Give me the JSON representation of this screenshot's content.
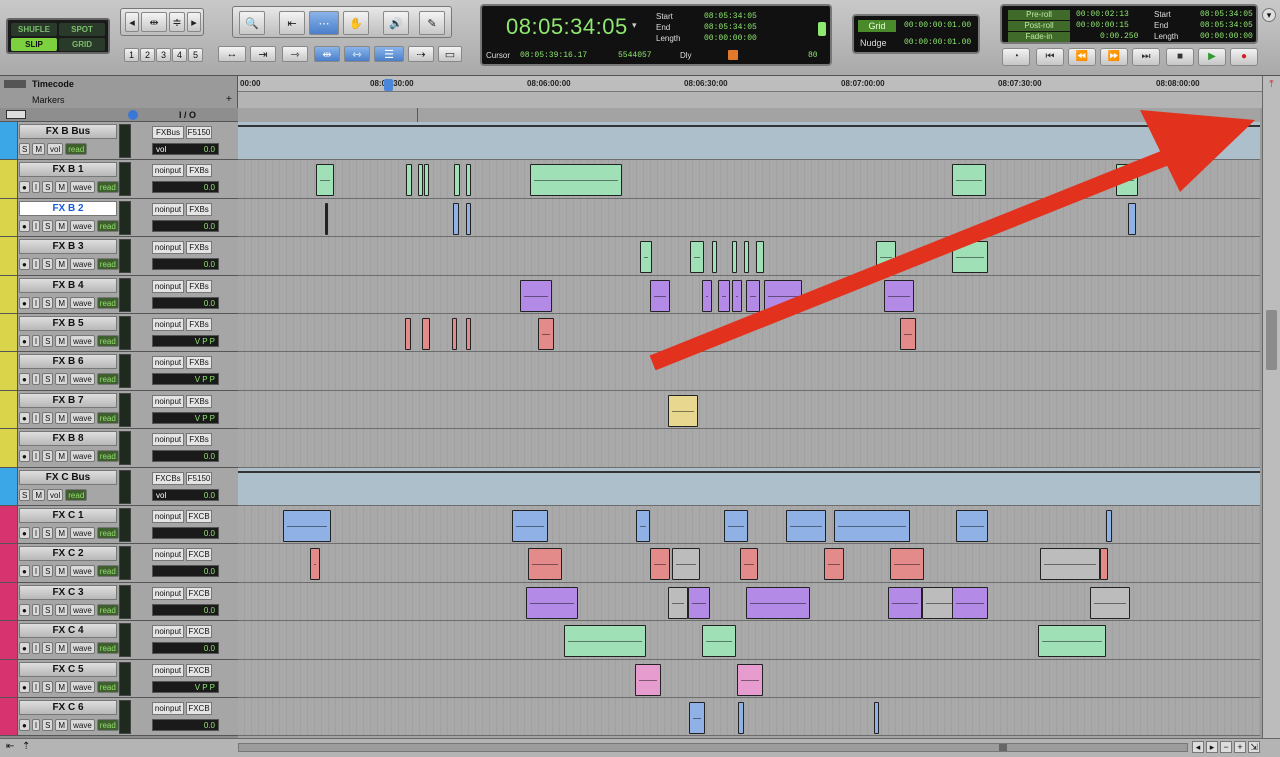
{
  "toolbar": {
    "edit_modes": [
      "SHUFLE",
      "SPOT",
      "SLIP",
      "GRID"
    ],
    "zoom_presets": [
      "1",
      "2",
      "3",
      "4",
      "5"
    ]
  },
  "counter": {
    "main_time": "08:05:34:05",
    "start_label": "Start",
    "start_value": "08:05:34:05",
    "end_label": "End",
    "end_value": "08:05:34:05",
    "length_label": "Length",
    "length_value": "00:00:00:00",
    "cursor_label": "Cursor",
    "cursor_value": "08:05:39:16.17",
    "sample_value": "5544057",
    "dly_label": "Dly",
    "nudge_value": "80"
  },
  "grid": {
    "grid_label": "Grid",
    "grid_value": "00:00:00:01.00",
    "nudge_label": "Nudge",
    "nudge_value": "00:00:00:01.00"
  },
  "transport": {
    "preroll_label": "Pre-roll",
    "preroll_value": "00:00:02:13",
    "postroll_label": "Post-roll",
    "postroll_value": "00:00:00:15",
    "fadein_label": "Fade-in",
    "fadein_value": "0:00.250",
    "start_label": "Start",
    "start_value": "08:05:34:05",
    "end_label": "End",
    "end_value": "08:05:34:05",
    "length_label": "Length",
    "length_value": "00:00:00:00"
  },
  "rulers": {
    "timecode_label": "Timecode",
    "markers_label": "Markers",
    "ticks": [
      "00:00",
      "08:05:30:00",
      "08:06:00:00",
      "08:06:30:00",
      "08:07:00:00",
      "08:07:30:00",
      "08:08:00:00"
    ]
  },
  "mix_header": {
    "io_label": "I / O"
  },
  "colors": {
    "aux_blue": "#3ba7e6",
    "fxb_yellow": "#d9d44a",
    "fxc_magenta": "#d6336f",
    "arrow_red": "#e2321e",
    "clip_green": "#9fe0b6",
    "clip_blue": "#8fb1e6",
    "clip_purple": "#b38be6",
    "clip_red": "#e38a8a",
    "clip_yellow": "#e8d88f",
    "clip_pink": "#e79ccf",
    "clip_gray": "#bcbcbc"
  },
  "tracks": [
    {
      "name": "FX B Bus",
      "type": "aux",
      "color": "#3ba7e6",
      "in": "FXBus",
      "out": "F5150",
      "vol_label": "vol",
      "vol_value": "0.0",
      "mode": "vol",
      "auto": "read"
    },
    {
      "name": "FX B 1",
      "type": "audio",
      "color": "#d9d44a",
      "in": "noinput",
      "out": "FXBs",
      "vol_value": "0.0",
      "mode": "wave",
      "auto": "read"
    },
    {
      "name": "FX B 2",
      "type": "audio",
      "color": "#d9d44a",
      "in": "noinput",
      "out": "FXBs",
      "vol_value": "0.0",
      "mode": "wave",
      "auto": "read",
      "selected": true
    },
    {
      "name": "FX B 3",
      "type": "audio",
      "color": "#d9d44a",
      "in": "noinput",
      "out": "FXBs",
      "vol_value": "0.0",
      "mode": "wave",
      "auto": "read"
    },
    {
      "name": "FX B 4",
      "type": "audio",
      "color": "#d9d44a",
      "in": "noinput",
      "out": "FXBs",
      "vol_value": "0.0",
      "mode": "wave",
      "auto": "read"
    },
    {
      "name": "FX B 5",
      "type": "audio",
      "color": "#d9d44a",
      "in": "noinput",
      "out": "FXBs",
      "vol_value": "V P P",
      "mode": "wave",
      "auto": "read"
    },
    {
      "name": "FX B 6",
      "type": "audio",
      "color": "#d9d44a",
      "in": "noinput",
      "out": "FXBs",
      "vol_value": "V P P",
      "mode": "wave",
      "auto": "read"
    },
    {
      "name": "FX B 7",
      "type": "audio",
      "color": "#d9d44a",
      "in": "noinput",
      "out": "FXBs",
      "vol_value": "V P P",
      "mode": "wave",
      "auto": "read"
    },
    {
      "name": "FX B 8",
      "type": "audio",
      "color": "#d9d44a",
      "in": "noinput",
      "out": "FXBs",
      "vol_value": "0.0",
      "mode": "wave",
      "auto": "read"
    },
    {
      "name": "FX C Bus",
      "type": "aux",
      "color": "#3ba7e6",
      "in": "FXCBs",
      "out": "F5150",
      "vol_label": "vol",
      "vol_value": "0.0",
      "mode": "vol",
      "auto": "read"
    },
    {
      "name": "FX C 1",
      "type": "audio",
      "color": "#d6336f",
      "in": "noinput",
      "out": "FXCB",
      "vol_value": "0.0",
      "mode": "wave",
      "auto": "read"
    },
    {
      "name": "FX C 2",
      "type": "audio",
      "color": "#d6336f",
      "in": "noinput",
      "out": "FXCB",
      "vol_value": "0.0",
      "mode": "wave",
      "auto": "read"
    },
    {
      "name": "FX C 3",
      "type": "audio",
      "color": "#d6336f",
      "in": "noinput",
      "out": "FXCB",
      "vol_value": "0.0",
      "mode": "wave",
      "auto": "read"
    },
    {
      "name": "FX C 4",
      "type": "audio",
      "color": "#d6336f",
      "in": "noinput",
      "out": "FXCB",
      "vol_value": "0.0",
      "mode": "wave",
      "auto": "read"
    },
    {
      "name": "FX C 5",
      "type": "audio",
      "color": "#d6336f",
      "in": "noinput",
      "out": "FXCB",
      "vol_value": "V P P",
      "mode": "wave",
      "auto": "read"
    },
    {
      "name": "FX C 6",
      "type": "audio",
      "color": "#d6336f",
      "in": "noinput",
      "out": "FXCB",
      "vol_value": "0.0",
      "mode": "wave",
      "auto": "read"
    }
  ]
}
